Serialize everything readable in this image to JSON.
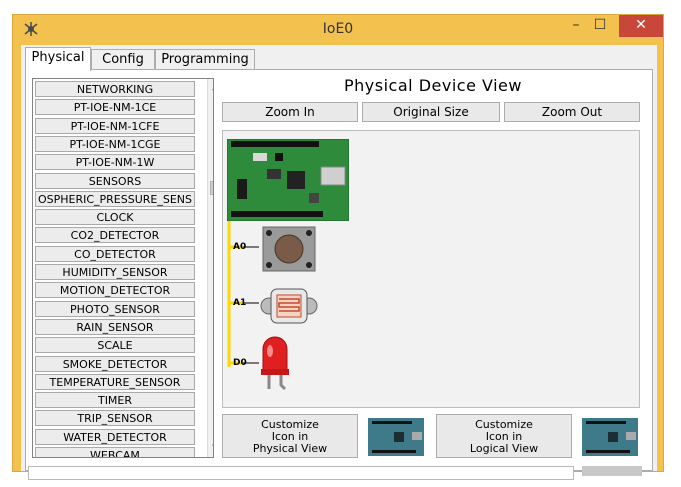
{
  "window": {
    "title": "IoE0",
    "minimize_glyph": "–",
    "maximize_glyph": "☐",
    "close_glyph": "✕",
    "app_icon": "packet-tracer-icon"
  },
  "tabs": [
    {
      "label": "Physical",
      "active": true
    },
    {
      "label": "Config",
      "active": false
    },
    {
      "label": "Programming",
      "active": false
    }
  ],
  "device_list": {
    "items": [
      "NETWORKING",
      "PT-IOE-NM-1CE",
      "PT-IOE-NM-1CFE",
      "PT-IOE-NM-1CGE",
      "PT-IOE-NM-1W",
      "SENSORS",
      "OSPHERIC_PRESSURE_SENS",
      "CLOCK",
      "CO2_DETECTOR",
      "CO_DETECTOR",
      "HUMIDITY_SENSOR",
      "MOTION_DETECTOR",
      "PHOTO_SENSOR",
      "RAIN_SENSOR",
      "SCALE",
      "SMOKE_DETECTOR",
      "TEMPERATURE_SENSOR",
      "TIMER",
      "TRIP_SENSOR",
      "WATER_DETECTOR",
      "WEBCAM"
    ],
    "scroll_up_glyph": "▲",
    "scroll_down_glyph": "▼"
  },
  "physical_view": {
    "title": "Physical Device View",
    "zoom_in": "Zoom In",
    "original_size": "Original Size",
    "zoom_out": "Zoom Out",
    "pins": [
      "A0",
      "A1",
      "D0"
    ]
  },
  "customize": {
    "physical": [
      "Customize",
      "Icon in",
      "Physical View"
    ],
    "logical": [
      "Customize",
      "Icon in",
      "Logical View"
    ]
  },
  "colors": {
    "window_frame": "#f3c24e",
    "close_button": "#c9473a",
    "board_green": "#2e8b3c",
    "wire_yellow": "#ffd800",
    "led_red": "#e02020"
  }
}
